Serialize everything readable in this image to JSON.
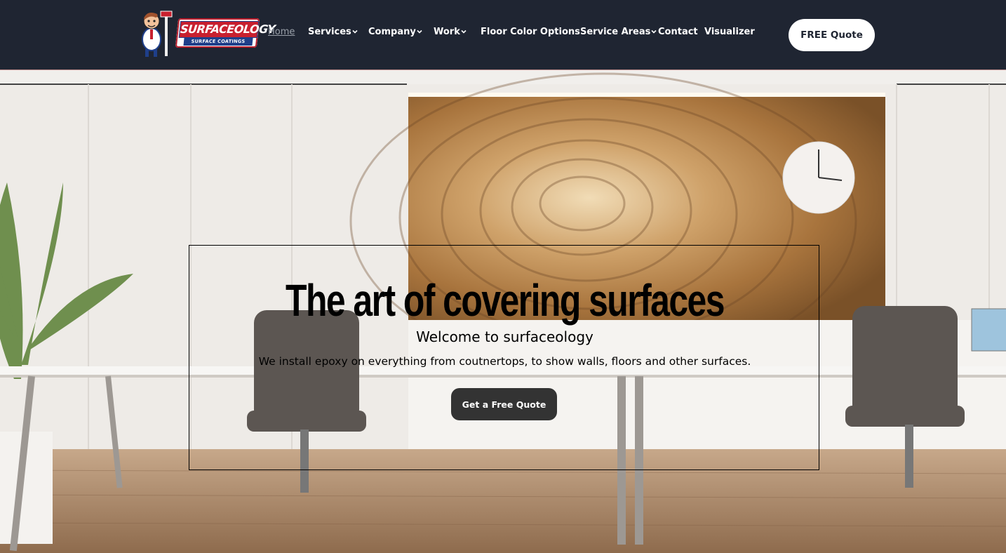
{
  "header": {
    "logo": {
      "word": "SURFACEOLOGY",
      "sub": "SURFACE COATINGS"
    },
    "nav": [
      {
        "label": "Home",
        "dropdown": false,
        "active": true
      },
      {
        "label": "Services",
        "dropdown": true
      },
      {
        "label": "Company",
        "dropdown": true
      },
      {
        "label": "Work",
        "dropdown": true
      },
      {
        "label": "Floor Color Options",
        "dropdown": false
      },
      {
        "label": "Service Areas",
        "dropdown": true
      },
      {
        "label": "Contact",
        "dropdown": false
      },
      {
        "label": "Visualizer",
        "dropdown": false
      }
    ],
    "quote_button": "FREE Quote"
  },
  "hero": {
    "headline": "The art of covering surfaces",
    "welcome": "Welcome to surfaceology",
    "tagline": "We install epoxy on everything from coutnertops, to show walls, floors and other surfaces.",
    "cta": "Get a Free Quote"
  },
  "icons": [
    "chevron-down-icon",
    "mascot-icon"
  ],
  "colors": {
    "header_bg": "#1f2532",
    "brand_red": "#c8202f",
    "brand_blue": "#1f3f8a",
    "cta_bg": "#333333"
  }
}
